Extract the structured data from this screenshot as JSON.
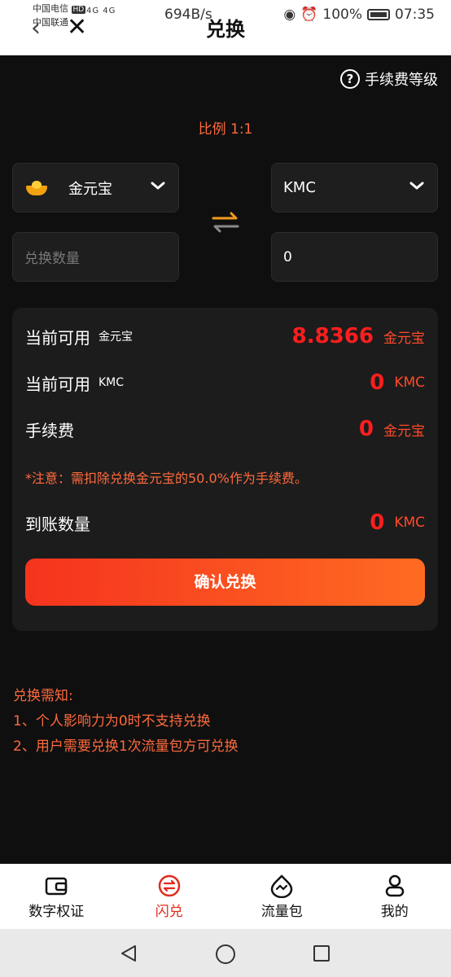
{
  "status_bar": {
    "carrier1": "中国电信",
    "carrier2": "中国联通",
    "hd_badge": "HD",
    "signal": "4G 4G",
    "speed": "694B/s",
    "battery": "100%",
    "time": "07:35"
  },
  "header": {
    "title": "兑换"
  },
  "fee_level_link": "手续费等级",
  "ratio": "比例 1:1",
  "from_select": {
    "value": "金元宝"
  },
  "to_select": {
    "value": "KMC"
  },
  "amount_input": {
    "placeholder": "兑换数量"
  },
  "result_input": {
    "value": "0"
  },
  "card": {
    "available_from": {
      "label": "当前可用",
      "sub": "金元宝",
      "value": "8.8366",
      "unit": "金元宝"
    },
    "available_to": {
      "label": "当前可用",
      "sub": "KMC",
      "value": "0",
      "unit": "KMC"
    },
    "fee": {
      "label": "手续费",
      "value": "0",
      "unit": "金元宝"
    },
    "notice": "*注意：需扣除兑换金元宝的50.0%作为手续费。",
    "received": {
      "label": "到账数量",
      "value": "0",
      "unit": "KMC"
    },
    "confirm_label": "确认兑换"
  },
  "notes": {
    "title": "兑换需知:",
    "items": [
      "1、个人影响力为0时不支持兑换",
      "2、用户需要兑换1次流量包方可兑换"
    ]
  },
  "bottom_nav": [
    {
      "label": "数字权证",
      "icon": "wallet-icon"
    },
    {
      "label": "闪兑",
      "icon": "exchange-icon"
    },
    {
      "label": "流量包",
      "icon": "drop-icon"
    },
    {
      "label": "我的",
      "icon": "user-icon"
    }
  ],
  "colors": {
    "accent": "#ff6a3d",
    "value_red": "#ff1e1e",
    "button_start": "#f5331e",
    "button_end": "#ff6b22",
    "nav_active": "#e02a1e"
  }
}
